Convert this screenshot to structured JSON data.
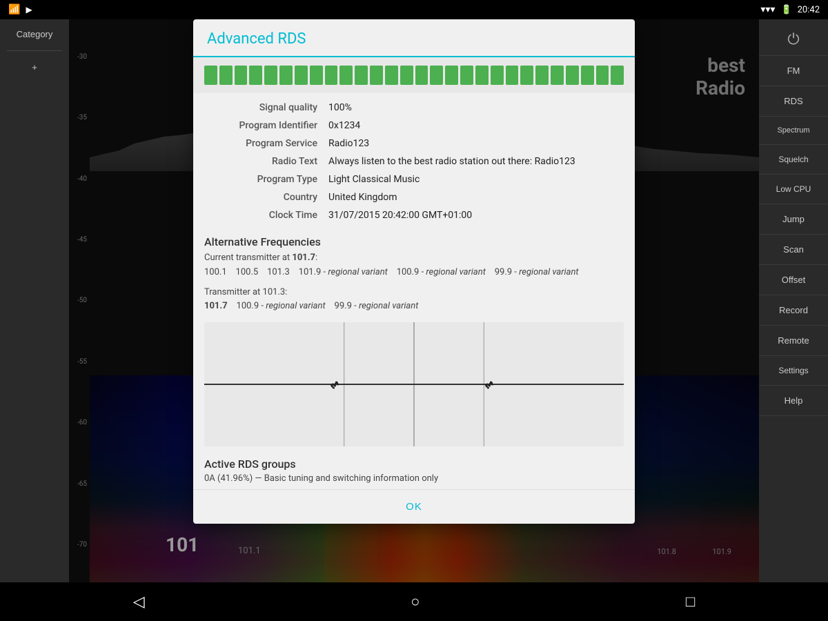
{
  "statusBar": {
    "time": "20:42",
    "wifiIcon": "wifi",
    "batteryIcon": "battery",
    "playIcon": "play"
  },
  "leftSidebar": {
    "categoryLabel": "Category",
    "addLabel": "+"
  },
  "rightSidebar": {
    "buttons": [
      {
        "id": "power",
        "label": "⏻"
      },
      {
        "id": "fm",
        "label": "FM"
      },
      {
        "id": "rds",
        "label": "RDS"
      },
      {
        "id": "spectrum",
        "label": "Spectrum"
      },
      {
        "id": "squelch",
        "label": "Squelch"
      },
      {
        "id": "lowcpu",
        "label": "Low CPU"
      },
      {
        "id": "jump",
        "label": "Jump"
      },
      {
        "id": "scan",
        "label": "Scan"
      },
      {
        "id": "offset",
        "label": "Offset"
      },
      {
        "id": "record",
        "label": "Record"
      },
      {
        "id": "remote",
        "label": "Remote"
      },
      {
        "id": "settings",
        "label": "Settings"
      },
      {
        "id": "help",
        "label": "Help"
      }
    ]
  },
  "spectrum": {
    "yLabels": [
      "-30",
      "-35",
      "-40",
      "-45",
      "-50",
      "-55",
      "-60",
      "-65",
      "-70"
    ],
    "currentFreq": "101",
    "currentFreqSub": "101.1",
    "freqRight1": "101.8",
    "freqRight2": "101.9",
    "bestRadioLine1": "best",
    "bestRadioLine2": "Radio"
  },
  "dialog": {
    "title": "Advanced RDS",
    "signalSegments": 28,
    "fields": [
      {
        "label": "Signal quality",
        "value": "100%"
      },
      {
        "label": "Program Identifier",
        "value": "0x1234"
      },
      {
        "label": "Program Service",
        "value": "Radio123"
      },
      {
        "label": "Radio Text",
        "value": "Always listen to the best radio station out there: Radio123"
      },
      {
        "label": "Program Type",
        "value": "Light Classical Music"
      },
      {
        "label": "Country",
        "value": "United Kingdom"
      },
      {
        "label": "Clock Time",
        "value": "31/07/2015 20:42:00 GMT+01:00"
      }
    ],
    "altFreqTitle": "Alternative Frequencies",
    "altFreqCurrentTransmitter": "Current transmitter at 101.7:",
    "altFreqCurrentList": "100.1   100.5   101.3   101.9 - regional variant   100.9 - regional variant   99.9 - regional variant",
    "altFreqTransmitterAt": "Transmitter at 101.3:",
    "altFreqTransmitterList": "101.7   100.9 - regional variant   99.9 - regional variant",
    "activeRdsTitle": "Active RDS groups",
    "activeRdsText": "0A (41.96%) — Basic tuning and switching information only",
    "okLabel": "OK"
  },
  "navBar": {
    "backIcon": "◁",
    "homeIcon": "○",
    "recentIcon": "□"
  }
}
